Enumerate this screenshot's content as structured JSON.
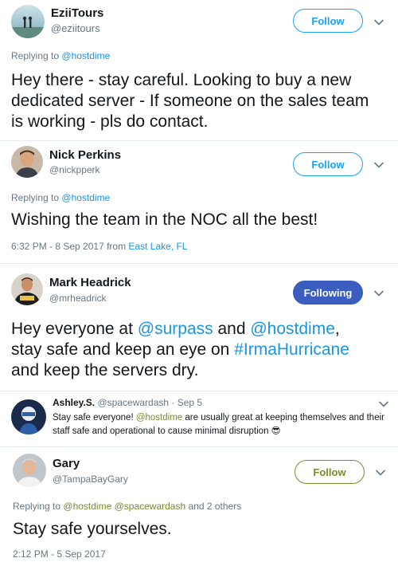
{
  "tweets": [
    {
      "name": "EziiTours",
      "handle": "@eziitours",
      "follow_label": "Follow",
      "replying_prefix": "Replying to",
      "replying_to": "@hostdime",
      "body": "Hey there - stay careful. Looking to buy a new dedicated server - If someone on the sales team is working - pls do contact."
    },
    {
      "name": "Nick Perkins",
      "handle": "@nickpperk",
      "follow_label": "Follow",
      "replying_prefix": "Replying to",
      "replying_to": "@hostdime",
      "body": "Wishing the team in the NOC all the best!",
      "timestamp": "6:32 PM - 8 Sep 2017 from",
      "location": "East Lake, FL"
    },
    {
      "name": "Mark Headrick",
      "handle": "@mrheadrick",
      "follow_label": "Following",
      "body_parts": [
        "Hey everyone at ",
        "@surpass",
        " and ",
        "@hostdime",
        ",",
        "stay safe and keep an eye on ",
        "#IrmaHurricane",
        "and keep the servers dry."
      ]
    },
    {
      "name": "Ashley.S.",
      "handle": "@spacewardash",
      "date": "· Sep 5",
      "body_parts": [
        "Stay safe everyone! ",
        "@hostdime",
        " are usually great at keeping themselves and their",
        "staff safe and operational to cause minimal disruption ",
        "😎"
      ]
    },
    {
      "name": "Gary",
      "handle": "@TampaBayGary",
      "follow_label": "Follow",
      "replying_prefix": "Replying to",
      "replying_to": "@hostdime @spacewardash",
      "replying_suffix": "and 2 others",
      "body": "Stay safe yourselves.",
      "timestamp": "2:12 PM - 5 Sep 2017"
    }
  ],
  "icons": {
    "chevron": "chevron-down-icon"
  },
  "colors": {
    "twitter_blue": "#1da1f2",
    "link_blue": "#1b95e0",
    "following_fill": "#3b5dbf",
    "olive": "#7c8a2e",
    "secondary_text": "#657786"
  }
}
